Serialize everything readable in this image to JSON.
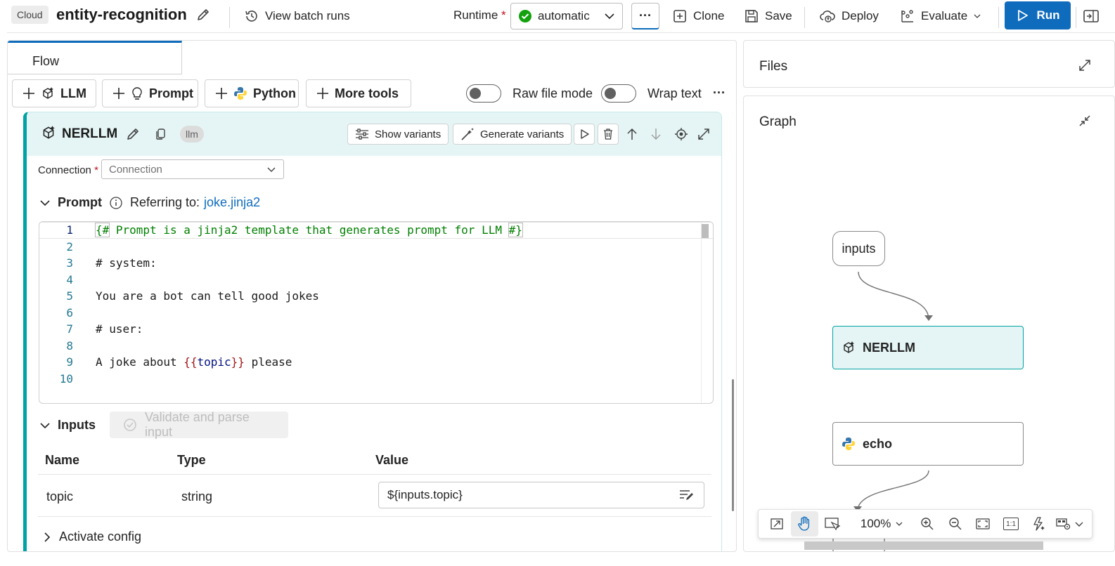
{
  "topbar": {
    "cloud_badge": "Cloud",
    "flow_name": "entity-recognition",
    "view_batch_runs": "View batch runs",
    "runtime_label": "Runtime",
    "runtime_required": "*",
    "runtime_value": "automatic",
    "more_label": "···",
    "clone": "Clone",
    "save": "Save",
    "deploy": "Deploy",
    "evaluate": "Evaluate",
    "run": "Run",
    "accent_color": "#0f6cbd"
  },
  "flow_tab": {
    "label": "Flow"
  },
  "tools": {
    "llm": "LLM",
    "prompt": "Prompt",
    "python": "Python",
    "more_tools": "More tools",
    "raw_file_mode": "Raw file mode",
    "wrap_text": "Wrap text",
    "raw_file_mode_on": false,
    "wrap_text_on": false
  },
  "node": {
    "name": "NERLLM",
    "type_badge": "llm",
    "show_variants": "Show variants",
    "generate_variants": "Generate variants",
    "connection_label": "Connection",
    "connection_required": "*",
    "connection_placeholder": "Connection",
    "prompt_section": "Prompt",
    "referring_to_label": "Referring to:",
    "referring_to_file": "joke.jinja2",
    "code_lines": [
      {
        "n": "1",
        "text": "{# Prompt is a jinja2 template that generates prompt for LLM #}"
      },
      {
        "n": "2",
        "text": ""
      },
      {
        "n": "3",
        "text": "# system:"
      },
      {
        "n": "4",
        "text": ""
      },
      {
        "n": "5",
        "text": "You are a bot can tell good jokes"
      },
      {
        "n": "6",
        "text": ""
      },
      {
        "n": "7",
        "text": "# user:"
      },
      {
        "n": "8",
        "text": ""
      },
      {
        "n": "9",
        "text": "A joke about {{topic}} please"
      },
      {
        "n": "10",
        "text": ""
      }
    ],
    "inputs_section": "Inputs",
    "validate_button": "Validate and parse input",
    "table_headers": {
      "name": "Name",
      "type": "Type",
      "value": "Value"
    },
    "inputs": [
      {
        "name": "topic",
        "type": "string",
        "value": "${inputs.topic}"
      }
    ],
    "activate_config": "Activate config"
  },
  "files_panel": {
    "title": "Files"
  },
  "graph_panel": {
    "title": "Graph",
    "nodes": [
      {
        "label": "inputs",
        "kind": "input"
      },
      {
        "label": "NERLLM",
        "kind": "llm",
        "selected": true
      },
      {
        "label": "echo",
        "kind": "python"
      }
    ],
    "zoom_level": "100%",
    "one_to_one": "1:1"
  }
}
